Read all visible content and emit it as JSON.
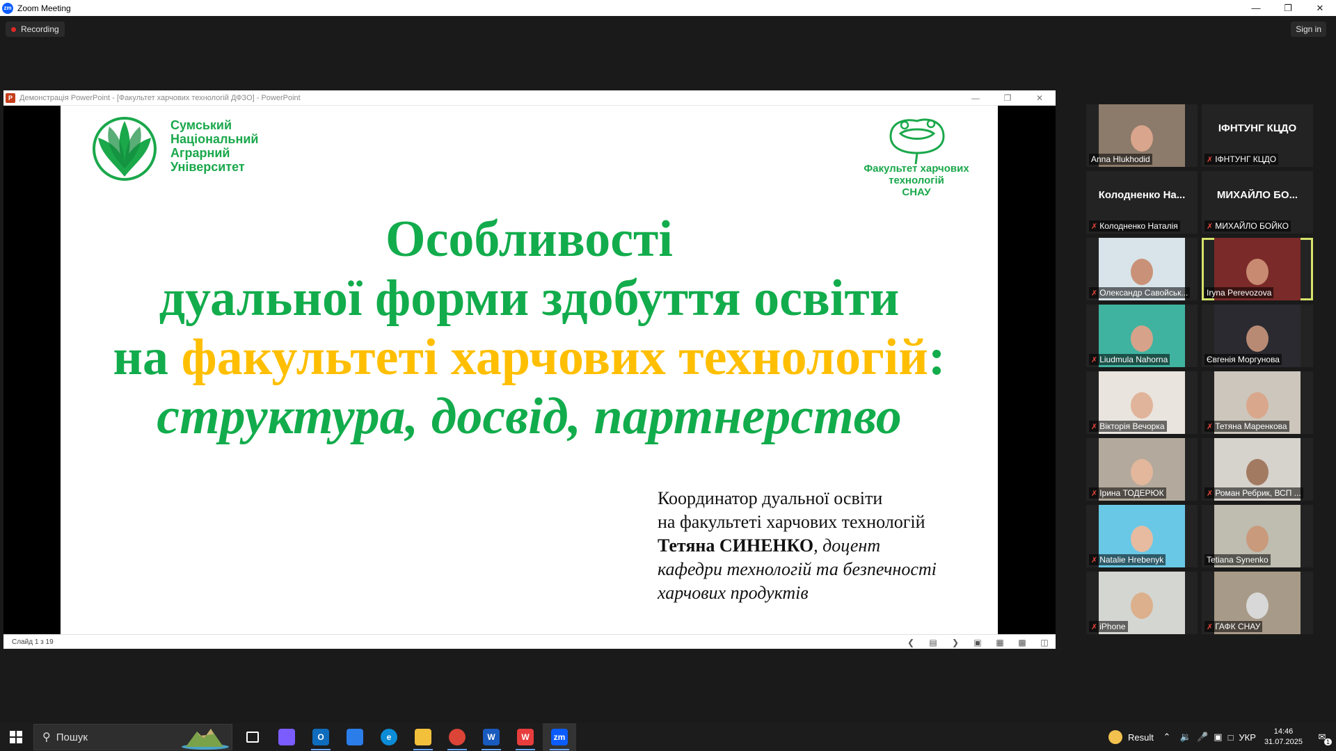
{
  "window": {
    "title": "Zoom Meeting",
    "logo": "zm"
  },
  "topbar": {
    "recording": "Recording",
    "sign_in": "Sign in"
  },
  "ppt": {
    "title": "Демонстрація PowerPoint - [Факультет харчових технологій ДФЗО] - PowerPoint",
    "slide_counter": "Слайд 1 з 19",
    "slide": {
      "university": [
        "Сумський",
        "Національний",
        "Аграрний",
        "Університет"
      ],
      "faculty": [
        "Факультет харчових",
        "технологій",
        "СНАУ"
      ],
      "title_line1": "Особливості",
      "title_line2": "дуальної форми здобуття освіти",
      "title_line3_prefix": "на ",
      "title_line3_highlight": "факультеті харчових технологій",
      "title_line3_suffix": ":",
      "title_line4": "структура, досвід, партнерство",
      "coord_line1": "Координатор дуальної освіти",
      "coord_line2": "на факультеті харчових технологій",
      "coord_name": "Тетяна СИНЕНКО",
      "coord_role": ", доцент",
      "coord_line4": "кафедри технологій та безпечності",
      "coord_line5": "харчових продуктів"
    }
  },
  "participants": [
    {
      "name": "Anna Hlukhodid",
      "muted": false,
      "video": true,
      "bg": "#8c7a6a",
      "face": "#d9a58c"
    },
    {
      "name": "ІФНТУНГ КЦДО",
      "initial": "ІФНТУНГ КЦДО",
      "muted": true,
      "video": false
    },
    {
      "name": "Колодненко Наталія",
      "initial": "Колодненко  На...",
      "muted": true,
      "video": false
    },
    {
      "name": "МИХАЙЛО БОЙКО",
      "initial": "МИХАЙЛО  БО...",
      "muted": true,
      "video": false
    },
    {
      "name": "Олександр Савойськ...",
      "muted": true,
      "video": true,
      "bg": "#d8e4ea",
      "face": "#c99278"
    },
    {
      "name": "Iryna Perevozova",
      "muted": false,
      "video": true,
      "active": true,
      "bg": "#7a2a28",
      "face": "#c98a72"
    },
    {
      "name": "Liudmula Nahorna",
      "muted": true,
      "video": true,
      "bg": "#3fb3a0",
      "face": "#d6a38a"
    },
    {
      "name": "Євгенія Моргунова",
      "muted": false,
      "video": true,
      "bg": "#2a2a30",
      "face": "#b88a74"
    },
    {
      "name": "Вікторія Вечорка",
      "muted": true,
      "video": true,
      "bg": "#e9e4de",
      "face": "#e0b49a"
    },
    {
      "name": "Тетяна Маренкова",
      "muted": true,
      "video": true,
      "bg": "#cdc6bc",
      "face": "#d9a88c"
    },
    {
      "name": "Ірина ТОДЕРЮК",
      "muted": true,
      "video": true,
      "bg": "#b3a99c",
      "face": "#e2b79c"
    },
    {
      "name": "Роман Ребрик, ВСП ...",
      "muted": true,
      "video": true,
      "bg": "#d6d2cc",
      "face": "#a27a62"
    },
    {
      "name": "Natalie Hrebenyk",
      "muted": true,
      "video": true,
      "bg": "#69c8e6",
      "face": "#e6bba0"
    },
    {
      "name": "Tetiana Synenko",
      "muted": false,
      "video": true,
      "bg": "#bfbcb0",
      "face": "#c99a7c"
    },
    {
      "name": "iPhone",
      "muted": true,
      "video": true,
      "bg": "#d4d6d2",
      "face": "#dcb08c"
    },
    {
      "name": "ГАФК СНАУ",
      "muted": true,
      "video": true,
      "bg": "#a89a88",
      "face": "#d8d8d8"
    }
  ],
  "taskbar": {
    "search_placeholder": "Пошук",
    "apps": [
      {
        "name": "task-view",
        "label": "",
        "color": "#1c1c1c"
      },
      {
        "name": "copilot",
        "label": "",
        "color": "#7a5cff"
      },
      {
        "name": "outlook",
        "label": "O",
        "color": "#0f6cbd"
      },
      {
        "name": "store",
        "label": "",
        "color": "#2b7de9"
      },
      {
        "name": "edge",
        "label": "e",
        "color": "#0c8bd6"
      },
      {
        "name": "explorer",
        "label": "",
        "color": "#f3c03c"
      },
      {
        "name": "chrome",
        "label": "",
        "color": "#db4437"
      },
      {
        "name": "word",
        "label": "W",
        "color": "#185abd"
      },
      {
        "name": "wps",
        "label": "W",
        "color": "#e83d3d"
      },
      {
        "name": "zoom",
        "label": "zm",
        "color": "#0b5cff"
      }
    ],
    "tray": {
      "result": "Result",
      "lang": "УКР",
      "time": "14:46",
      "date": "31.07.2025",
      "notifications": "1"
    }
  }
}
